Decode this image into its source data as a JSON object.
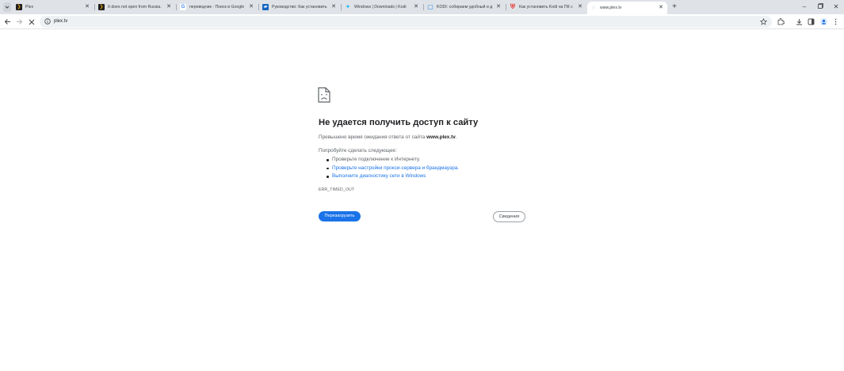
{
  "browser": {
    "tabs": [
      {
        "title": "Plex",
        "favicon": "plex-favicon",
        "favicon_color": "#1f1f1f",
        "favicon_glyph": "❯"
      },
      {
        "title": "It does not open from Russia.",
        "favicon": "plex-favicon",
        "favicon_color": "#1f1f1f",
        "favicon_glyph": "❯"
      },
      {
        "title": "переводчик - Поиск в Google",
        "favicon": "google-favicon",
        "favicon_color": "#4285f4",
        "favicon_glyph": "G"
      },
      {
        "title": "Руководство: Как установить",
        "favicon": "guide-favicon",
        "favicon_color": "#1565c0",
        "favicon_glyph": "▰"
      },
      {
        "title": "Windows | Downloads | Kodi",
        "favicon": "kodi-favicon",
        "favicon_color": "#29b6f6",
        "favicon_glyph": "✦"
      },
      {
        "title": "KODI: собираем удобный и д",
        "favicon": "kodi-article-favicon",
        "favicon_color": "#1e88e5",
        "favicon_glyph": "▢"
      },
      {
        "title": "Как установить Kodi на ПК с",
        "favicon": "shield-favicon",
        "favicon_color": "#e53935",
        "favicon_glyph": "⛨"
      },
      {
        "title": "www.plex.tv",
        "favicon": "loading-spinner-icon",
        "favicon_color": "#9aa0a6",
        "favicon_glyph": "◌",
        "active": true
      }
    ],
    "new_tab_label": "+",
    "address": "plex.tv"
  },
  "error_page": {
    "title": "Не удается получить доступ к сайту",
    "description_prefix": "Превышено время ожидания ответа от сайта ",
    "description_host": "www.plex.tv",
    "description_suffix": ".",
    "try_label": "Попробуйте сделать следующее:",
    "suggestions": [
      {
        "text": "Проверьте подключение к Интернету.",
        "link": false
      },
      {
        "text": "Проверьте настройки прокси-сервера и брандмауэра.",
        "link": true
      },
      {
        "text": "Выполните диагностику сети в Windows",
        "link": true
      }
    ],
    "error_code": "ERR_TIMED_OUT",
    "reload_button": "Перезагрузить",
    "details_button": "Сведения"
  },
  "colors": {
    "accent": "#1a73e8",
    "tabstrip": "#dfe3e8",
    "omnibox": "#eef1f4"
  }
}
